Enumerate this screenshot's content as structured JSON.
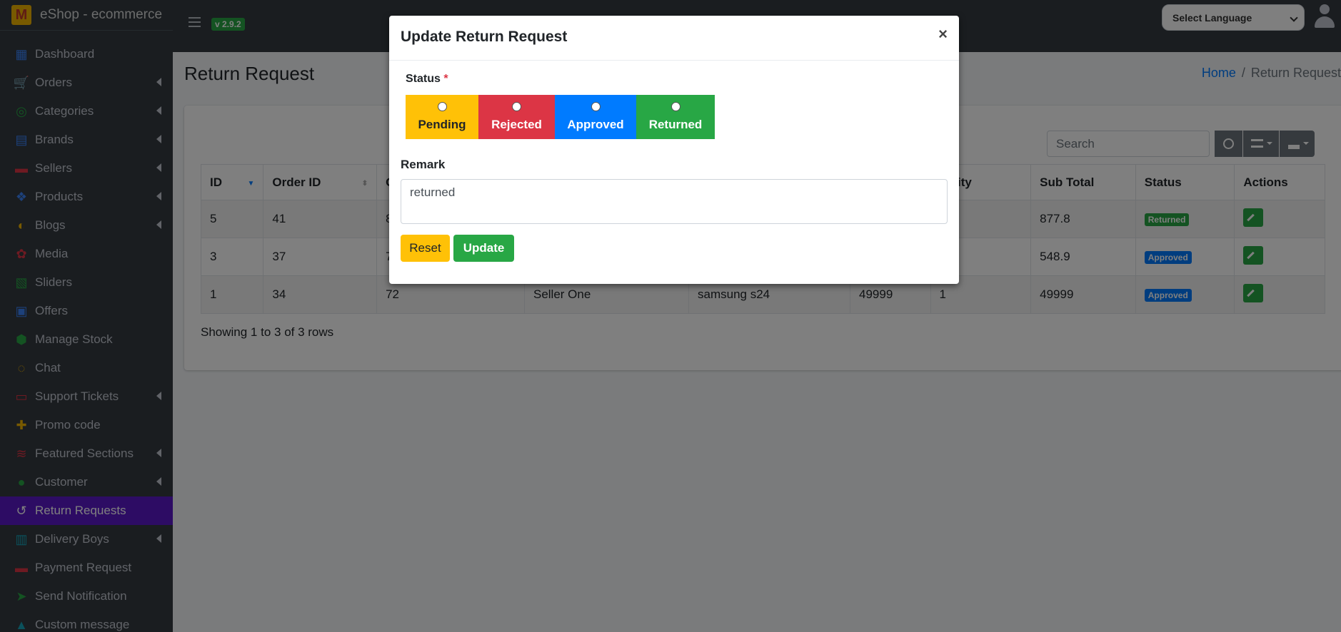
{
  "app": {
    "brand": "eShop - ecommerce",
    "version": "v 2.9.2"
  },
  "sidebar": {
    "items": [
      {
        "label": "Dashboard",
        "icon": "dashboard-icon",
        "color": "#3b82f6",
        "caret": false
      },
      {
        "label": "Orders",
        "icon": "cart-icon",
        "color": "#f0b400",
        "caret": true
      },
      {
        "label": "Categories",
        "icon": "categories-icon",
        "color": "#28a745",
        "caret": true
      },
      {
        "label": "Brands",
        "icon": "brands-icon",
        "color": "#3b82f6",
        "caret": true
      },
      {
        "label": "Sellers",
        "icon": "store-icon",
        "color": "#dc3545",
        "caret": true
      },
      {
        "label": "Products",
        "icon": "products-icon",
        "color": "#3b82f6",
        "caret": true
      },
      {
        "label": "Blogs",
        "icon": "blog-icon",
        "color": "#f0b400",
        "caret": true
      },
      {
        "label": "Media",
        "icon": "media-icon",
        "color": "#dc3545",
        "caret": false
      },
      {
        "label": "Sliders",
        "icon": "sliders-icon",
        "color": "#28a745",
        "caret": false
      },
      {
        "label": "Offers",
        "icon": "gift-icon",
        "color": "#3b82f6",
        "caret": false
      },
      {
        "label": "Manage Stock",
        "icon": "stock-icon",
        "color": "#28a745",
        "caret": false
      },
      {
        "label": "Chat",
        "icon": "chat-icon",
        "color": "#f0b400",
        "caret": false
      },
      {
        "label": "Support Tickets",
        "icon": "ticket-icon",
        "color": "#dc3545",
        "caret": true
      },
      {
        "label": "Promo code",
        "icon": "puzzle-icon",
        "color": "#f0b400",
        "caret": false
      },
      {
        "label": "Featured Sections",
        "icon": "layers-icon",
        "color": "#dc3545",
        "caret": true
      },
      {
        "label": "Customer",
        "icon": "user-icon",
        "color": "#28a745",
        "caret": true
      },
      {
        "label": "Return Requests",
        "icon": "undo-icon",
        "color": "#ffffff",
        "caret": false,
        "active": true
      },
      {
        "label": "Delivery Boys",
        "icon": "id-badge-icon",
        "color": "#17a2b8",
        "caret": true
      },
      {
        "label": "Payment Request",
        "icon": "money-icon",
        "color": "#dc3545",
        "caret": false
      },
      {
        "label": "Send Notification",
        "icon": "paper-plane-icon",
        "color": "#28a745",
        "caret": false
      },
      {
        "label": "Custom message",
        "icon": "bell-icon",
        "color": "#17a2b8",
        "caret": false
      }
    ]
  },
  "topbar": {
    "language_placeholder": "Select Language"
  },
  "page": {
    "title": "Return Request",
    "breadcrumb": {
      "home": "Home",
      "sep": "/",
      "current": "Return Request"
    }
  },
  "table": {
    "search_placeholder": "Search",
    "columns": [
      "ID",
      "Order ID",
      "O",
      "",
      "",
      "",
      "antity",
      "Sub Total",
      "Status",
      "Actions"
    ],
    "rows": [
      {
        "id": "5",
        "order_id": "41",
        "c3": "8",
        "c4": "",
        "c5": "",
        "c6": "",
        "c7": "",
        "sub_total": "877.8",
        "status": "Returned",
        "status_color": "#28a745"
      },
      {
        "id": "3",
        "order_id": "37",
        "c3": "7",
        "c4": "",
        "c5": "",
        "c6": "",
        "c7": "",
        "sub_total": "548.9",
        "status": "Approved",
        "status_color": "#007bff"
      },
      {
        "id": "1",
        "order_id": "34",
        "c3": "72",
        "c4": "Seller One",
        "c5": "samsung s24",
        "c6": "49999",
        "c7": "1",
        "sub_total": "49999",
        "status": "Approved",
        "status_color": "#007bff"
      }
    ],
    "footer": "Showing 1 to 3 of 3 rows"
  },
  "modal": {
    "title": "Update Return Request",
    "close": "×",
    "status_label": "Status",
    "required_mark": "*",
    "options": [
      "Pending",
      "Rejected",
      "Approved",
      "Returned"
    ],
    "remark_label": "Remark",
    "remark_value": "returned",
    "reset": "Reset",
    "update": "Update"
  }
}
